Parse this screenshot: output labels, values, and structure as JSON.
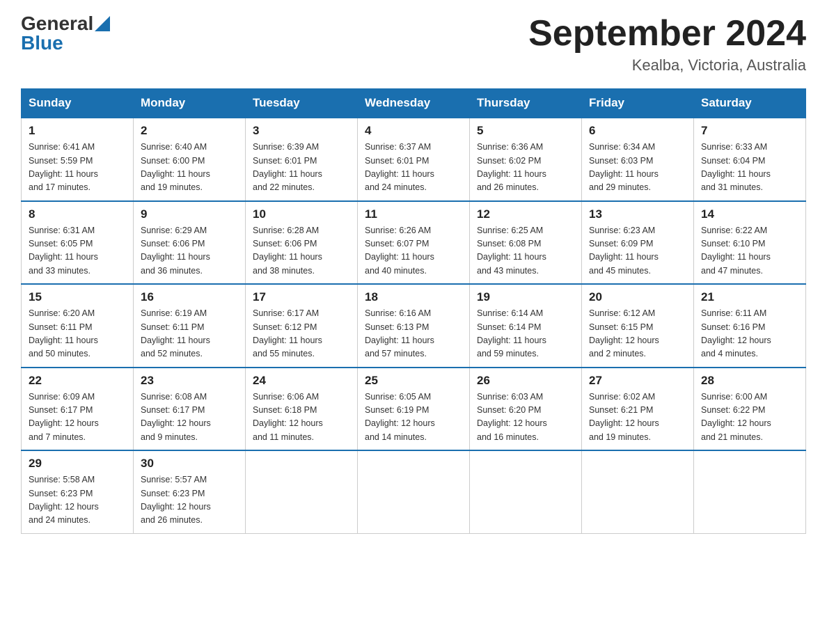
{
  "header": {
    "logo_general": "General",
    "logo_blue": "Blue",
    "month_title": "September 2024",
    "location": "Kealba, Victoria, Australia"
  },
  "weekdays": [
    "Sunday",
    "Monday",
    "Tuesday",
    "Wednesday",
    "Thursday",
    "Friday",
    "Saturday"
  ],
  "weeks": [
    [
      {
        "day": "1",
        "sunrise": "6:41 AM",
        "sunset": "5:59 PM",
        "daylight": "11 hours and 17 minutes."
      },
      {
        "day": "2",
        "sunrise": "6:40 AM",
        "sunset": "6:00 PM",
        "daylight": "11 hours and 19 minutes."
      },
      {
        "day": "3",
        "sunrise": "6:39 AM",
        "sunset": "6:01 PM",
        "daylight": "11 hours and 22 minutes."
      },
      {
        "day": "4",
        "sunrise": "6:37 AM",
        "sunset": "6:01 PM",
        "daylight": "11 hours and 24 minutes."
      },
      {
        "day": "5",
        "sunrise": "6:36 AM",
        "sunset": "6:02 PM",
        "daylight": "11 hours and 26 minutes."
      },
      {
        "day": "6",
        "sunrise": "6:34 AM",
        "sunset": "6:03 PM",
        "daylight": "11 hours and 29 minutes."
      },
      {
        "day": "7",
        "sunrise": "6:33 AM",
        "sunset": "6:04 PM",
        "daylight": "11 hours and 31 minutes."
      }
    ],
    [
      {
        "day": "8",
        "sunrise": "6:31 AM",
        "sunset": "6:05 PM",
        "daylight": "11 hours and 33 minutes."
      },
      {
        "day": "9",
        "sunrise": "6:29 AM",
        "sunset": "6:06 PM",
        "daylight": "11 hours and 36 minutes."
      },
      {
        "day": "10",
        "sunrise": "6:28 AM",
        "sunset": "6:06 PM",
        "daylight": "11 hours and 38 minutes."
      },
      {
        "day": "11",
        "sunrise": "6:26 AM",
        "sunset": "6:07 PM",
        "daylight": "11 hours and 40 minutes."
      },
      {
        "day": "12",
        "sunrise": "6:25 AM",
        "sunset": "6:08 PM",
        "daylight": "11 hours and 43 minutes."
      },
      {
        "day": "13",
        "sunrise": "6:23 AM",
        "sunset": "6:09 PM",
        "daylight": "11 hours and 45 minutes."
      },
      {
        "day": "14",
        "sunrise": "6:22 AM",
        "sunset": "6:10 PM",
        "daylight": "11 hours and 47 minutes."
      }
    ],
    [
      {
        "day": "15",
        "sunrise": "6:20 AM",
        "sunset": "6:11 PM",
        "daylight": "11 hours and 50 minutes."
      },
      {
        "day": "16",
        "sunrise": "6:19 AM",
        "sunset": "6:11 PM",
        "daylight": "11 hours and 52 minutes."
      },
      {
        "day": "17",
        "sunrise": "6:17 AM",
        "sunset": "6:12 PM",
        "daylight": "11 hours and 55 minutes."
      },
      {
        "day": "18",
        "sunrise": "6:16 AM",
        "sunset": "6:13 PM",
        "daylight": "11 hours and 57 minutes."
      },
      {
        "day": "19",
        "sunrise": "6:14 AM",
        "sunset": "6:14 PM",
        "daylight": "11 hours and 59 minutes."
      },
      {
        "day": "20",
        "sunrise": "6:12 AM",
        "sunset": "6:15 PM",
        "daylight": "12 hours and 2 minutes."
      },
      {
        "day": "21",
        "sunrise": "6:11 AM",
        "sunset": "6:16 PM",
        "daylight": "12 hours and 4 minutes."
      }
    ],
    [
      {
        "day": "22",
        "sunrise": "6:09 AM",
        "sunset": "6:17 PM",
        "daylight": "12 hours and 7 minutes."
      },
      {
        "day": "23",
        "sunrise": "6:08 AM",
        "sunset": "6:17 PM",
        "daylight": "12 hours and 9 minutes."
      },
      {
        "day": "24",
        "sunrise": "6:06 AM",
        "sunset": "6:18 PM",
        "daylight": "12 hours and 11 minutes."
      },
      {
        "day": "25",
        "sunrise": "6:05 AM",
        "sunset": "6:19 PM",
        "daylight": "12 hours and 14 minutes."
      },
      {
        "day": "26",
        "sunrise": "6:03 AM",
        "sunset": "6:20 PM",
        "daylight": "12 hours and 16 minutes."
      },
      {
        "day": "27",
        "sunrise": "6:02 AM",
        "sunset": "6:21 PM",
        "daylight": "12 hours and 19 minutes."
      },
      {
        "day": "28",
        "sunrise": "6:00 AM",
        "sunset": "6:22 PM",
        "daylight": "12 hours and 21 minutes."
      }
    ],
    [
      {
        "day": "29",
        "sunrise": "5:58 AM",
        "sunset": "6:23 PM",
        "daylight": "12 hours and 24 minutes."
      },
      {
        "day": "30",
        "sunrise": "5:57 AM",
        "sunset": "6:23 PM",
        "daylight": "12 hours and 26 minutes."
      },
      null,
      null,
      null,
      null,
      null
    ]
  ],
  "labels": {
    "sunrise_prefix": "Sunrise: ",
    "sunset_prefix": "Sunset: ",
    "daylight_prefix": "Daylight: "
  }
}
